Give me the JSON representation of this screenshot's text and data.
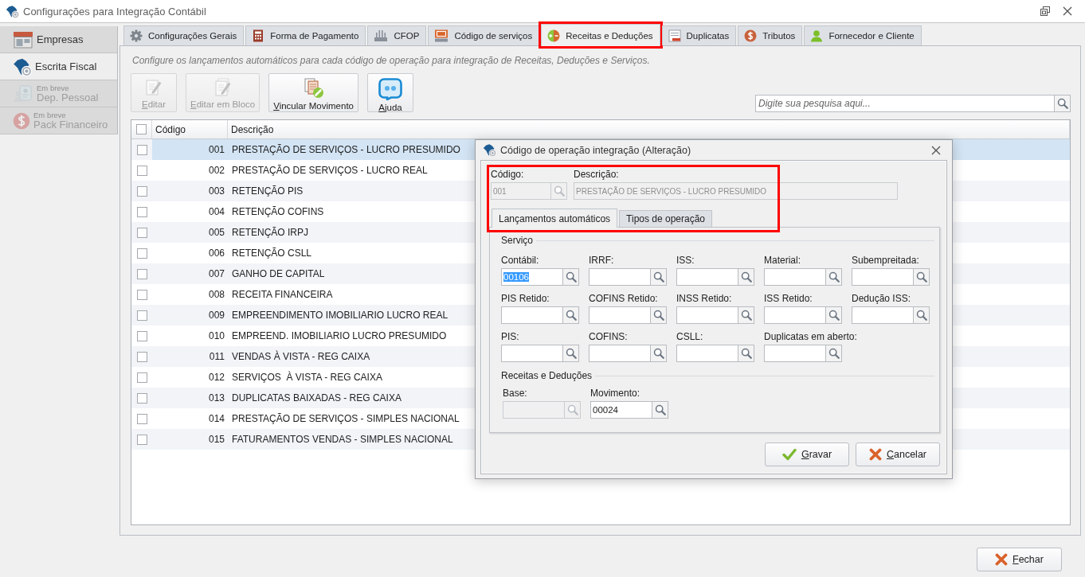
{
  "window": {
    "title": "Configurações para Integração Contábil"
  },
  "sidebar": {
    "items": [
      {
        "label": "Empresas",
        "selected": false,
        "disabled": false
      },
      {
        "label": "Escrita Fiscal",
        "selected": true,
        "disabled": false
      },
      {
        "note": "Em breve",
        "label": "Dep. Pessoal",
        "selected": false,
        "disabled": true
      },
      {
        "note": "Em breve",
        "label": "Pack Financeiro",
        "selected": false,
        "disabled": true
      }
    ]
  },
  "tabs": [
    {
      "label": "Configurações Gerais",
      "selected": false,
      "highlighted": false
    },
    {
      "label": "Forma de Pagamento",
      "selected": false,
      "highlighted": false
    },
    {
      "label": "CFOP",
      "selected": false,
      "highlighted": false
    },
    {
      "label": "Código de serviços",
      "selected": false,
      "highlighted": false
    },
    {
      "label": "Receitas e Deduções",
      "selected": true,
      "highlighted": true
    },
    {
      "label": "Duplicatas",
      "selected": false,
      "highlighted": false
    },
    {
      "label": "Tributos",
      "selected": false,
      "highlighted": false
    },
    {
      "label": "Fornecedor e Cliente",
      "selected": false,
      "highlighted": false
    }
  ],
  "instructions": "Configure os lançamentos automáticos para cada código de operação para integração de Receitas, Deduções e Serviços.",
  "toolbar": {
    "buttons": [
      {
        "label": "Editar",
        "disabled": true
      },
      {
        "label": "Editar em Bloco",
        "disabled": true
      },
      {
        "label": "Vincular Movimento",
        "disabled": false
      },
      {
        "label": "Ajuda",
        "disabled": false
      }
    ],
    "search": {
      "placeholder": "Digite sua pesquisa aqui..."
    }
  },
  "table": {
    "select_all": {
      "checked": false
    },
    "columns": [
      "Código",
      "Descrição"
    ],
    "rows": [
      {
        "code": "001",
        "description": "PRESTAÇÃO DE SERVIÇOS - LUCRO PRESUMIDO",
        "checked": false,
        "selected": true
      },
      {
        "code": "002",
        "description": "PRESTAÇÃO DE SERVIÇOS - LUCRO REAL",
        "checked": false,
        "selected": false
      },
      {
        "code": "003",
        "description": "RETENÇÃO PIS",
        "checked": false,
        "selected": false
      },
      {
        "code": "004",
        "description": "RETENÇÃO COFINS",
        "checked": false,
        "selected": false
      },
      {
        "code": "005",
        "description": "RETENÇÃO IRPJ",
        "checked": false,
        "selected": false
      },
      {
        "code": "006",
        "description": "RETENÇÃO CSLL",
        "checked": false,
        "selected": false
      },
      {
        "code": "007",
        "description": "GANHO DE CAPITAL",
        "checked": false,
        "selected": false
      },
      {
        "code": "008",
        "description": "RECEITA FINANCEIRA",
        "checked": false,
        "selected": false
      },
      {
        "code": "009",
        "description": "EMPREENDIMENTO IMOBILIARIO LUCRO REAL",
        "checked": false,
        "selected": false
      },
      {
        "code": "010",
        "description": "EMPREEND. IMOBILIARIO LUCRO PRESUMIDO",
        "checked": false,
        "selected": false
      },
      {
        "code": "011",
        "description": "VENDAS À VISTA - REG CAIXA",
        "checked": false,
        "selected": false
      },
      {
        "code": "012",
        "description": "SERVIÇOS  À VISTA - REG CAIXA",
        "checked": false,
        "selected": false
      },
      {
        "code": "013",
        "description": "DUPLICATAS BAIXADAS - REG CAIXA",
        "checked": false,
        "selected": false
      },
      {
        "code": "014",
        "description": "PRESTAÇÃO DE SERVIÇOS - SIMPLES NACIONAL",
        "checked": false,
        "selected": false
      },
      {
        "code": "015",
        "description": "FATURAMENTOS VENDAS - SIMPLES NACIONAL",
        "checked": false,
        "selected": false
      }
    ]
  },
  "dialog": {
    "title": "Código de operação integração (Alteração)",
    "highlighted": true,
    "code": {
      "label": "Código:",
      "value": "001",
      "disabled": true
    },
    "description": {
      "label": "Descrição:",
      "value": "PRESTAÇÃO DE SERVIÇOS - LUCRO PRESUMIDO",
      "disabled": true
    },
    "tabs": [
      {
        "label": "Lançamentos automáticos",
        "selected": true
      },
      {
        "label": "Tipos de operação",
        "selected": false
      }
    ],
    "groups": [
      {
        "title": "Serviço",
        "fields": [
          {
            "label": "Contábil:",
            "value": "00106",
            "disabled": false,
            "text_selected": true
          },
          {
            "label": "IRRF:",
            "disabled": false
          },
          {
            "label": "ISS:",
            "disabled": false
          },
          {
            "label": "Material:",
            "disabled": false
          },
          {
            "label": "Subempreitada:",
            "disabled": false
          },
          {
            "label": "PIS Retido:",
            "disabled": false
          },
          {
            "label": "COFINS Retido:",
            "disabled": false
          },
          {
            "label": "INSS Retido:",
            "disabled": false
          },
          {
            "label": "ISS Retido:",
            "disabled": false
          },
          {
            "label": "Dedução ISS:",
            "disabled": false
          },
          {
            "label": "PIS:",
            "disabled": false
          },
          {
            "label": "COFINS:",
            "disabled": false
          },
          {
            "label": "CSLL:",
            "disabled": false
          },
          {
            "label": "Duplicatas em aberto:",
            "disabled": false
          }
        ]
      },
      {
        "title": "Receitas e Deduções",
        "fields": [
          {
            "label": "Base:",
            "disabled": true
          },
          {
            "label": "Movimento:",
            "value": "00024",
            "disabled": false,
            "text_selected": false
          }
        ]
      }
    ],
    "buttons": [
      {
        "label": "Gravar",
        "kind": "confirm"
      },
      {
        "label": "Cancelar",
        "kind": "cancel"
      }
    ]
  },
  "footer": {
    "buttons": [
      {
        "label": "Fechar",
        "kind": "cancel"
      }
    ]
  }
}
